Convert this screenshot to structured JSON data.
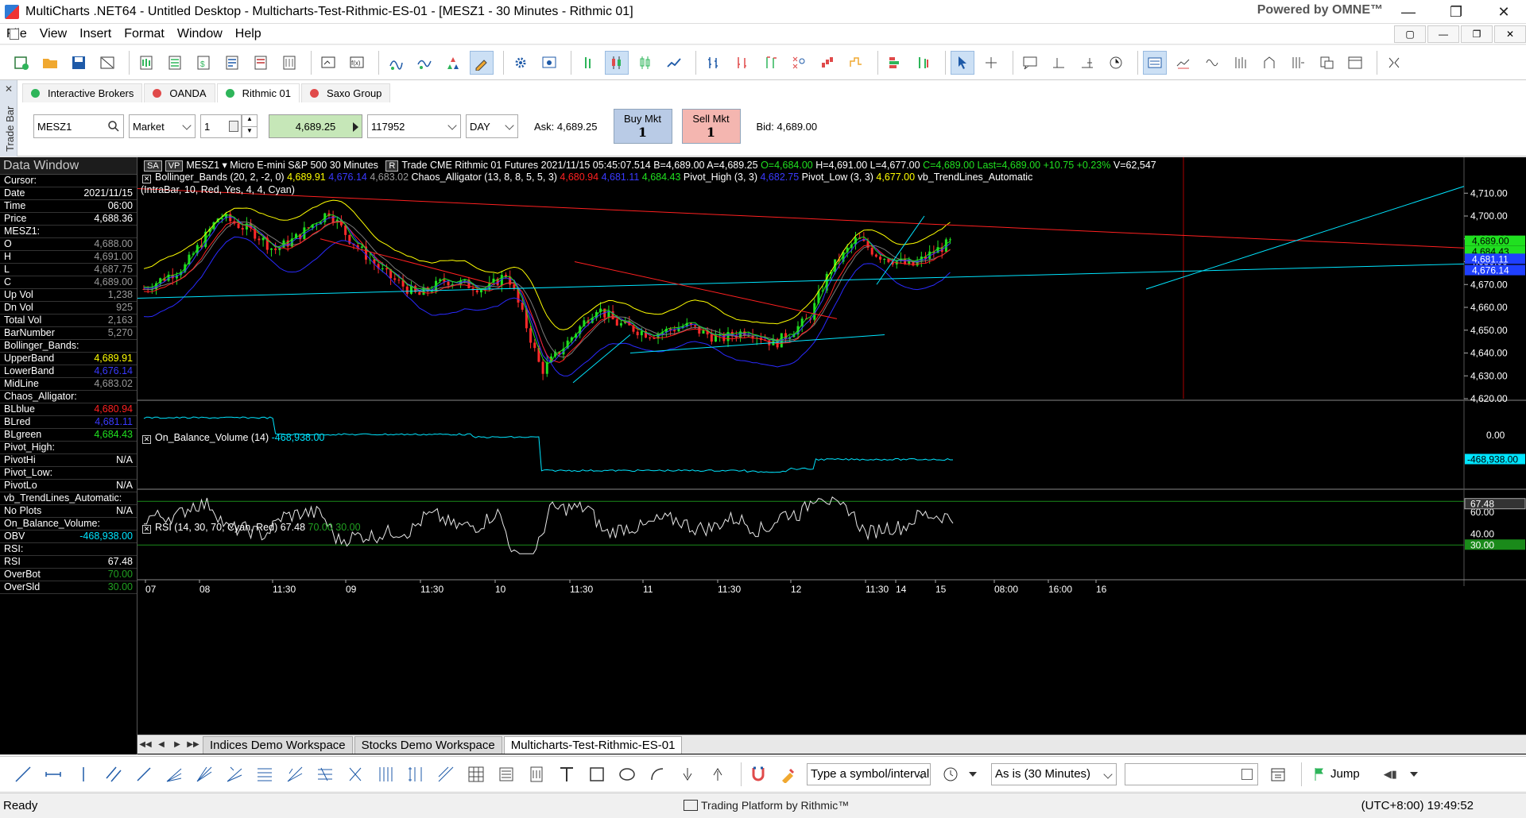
{
  "window": {
    "title": "MultiCharts .NET64 - Untitled Desktop - Multicharts-Test-Rithmic-ES-01 - [MESZ1 - 30 Minutes - Rithmic 01]",
    "powered": "Powered by OMNE™"
  },
  "menu": [
    "File",
    "View",
    "Insert",
    "Format",
    "Window",
    "Help"
  ],
  "tradebar": {
    "side_label": "Trade Bar",
    "brokers": [
      {
        "label": "Interactive Brokers",
        "color": "#2eb55a"
      },
      {
        "label": "OANDA",
        "color": "#e04a4a"
      },
      {
        "label": "Rithmic 01",
        "color": "#2eb55a"
      },
      {
        "label": "Saxo Group",
        "color": "#e04a4a"
      }
    ],
    "symbol": "MESZ1",
    "order_type": "Market",
    "quantity": "1",
    "price": "4,689.25",
    "account": "117952",
    "tif": "DAY",
    "ask": "Ask: 4,689.25",
    "buy_label": "Buy Mkt",
    "buy_qty": "1",
    "sell_label": "Sell Mkt",
    "sell_qty": "1",
    "bid": "Bid: 4,689.00"
  },
  "data_window": {
    "title": "Data Window",
    "rows": [
      {
        "k": "Cursor:",
        "v": "",
        "sec": true
      },
      {
        "k": "Date",
        "v": "2021/11/15",
        "c": "#ffffff"
      },
      {
        "k": "Time",
        "v": "06:00",
        "c": "#ffffff"
      },
      {
        "k": "Price",
        "v": "4,688.36",
        "c": "#ffffff"
      },
      {
        "k": "MESZ1:",
        "v": "",
        "sec": true
      },
      {
        "k": "O",
        "v": "4,688.00",
        "c": "#9a9a9a"
      },
      {
        "k": "H",
        "v": "4,691.00",
        "c": "#9a9a9a"
      },
      {
        "k": "L",
        "v": "4,687.75",
        "c": "#9a9a9a"
      },
      {
        "k": "C",
        "v": "4,689.00",
        "c": "#9a9a9a"
      },
      {
        "k": "Up Vol",
        "v": "1,238",
        "c": "#9a9a9a"
      },
      {
        "k": "Dn Vol",
        "v": "925",
        "c": "#9a9a9a"
      },
      {
        "k": "Total Vol",
        "v": "2,163",
        "c": "#9a9a9a"
      },
      {
        "k": "BarNumber",
        "v": "5,270",
        "c": "#9a9a9a"
      },
      {
        "k": "Bollinger_Bands:",
        "v": "",
        "sec": true
      },
      {
        "k": "UpperBand",
        "v": "4,689.91",
        "c": "#ffff00"
      },
      {
        "k": "LowerBand",
        "v": "4,676.14",
        "c": "#3a3aff"
      },
      {
        "k": "MidLine",
        "v": "4,683.02",
        "c": "#9a9a9a"
      },
      {
        "k": "Chaos_Alligator:",
        "v": "",
        "sec": true
      },
      {
        "k": "BLblue",
        "v": "4,680.94",
        "c": "#ff2020"
      },
      {
        "k": "BLred",
        "v": "4,681.11",
        "c": "#3a3aff"
      },
      {
        "k": "BLgreen",
        "v": "4,684.43",
        "c": "#20e020"
      },
      {
        "k": "Pivot_High:",
        "v": "",
        "sec": true
      },
      {
        "k": "PivotHi",
        "v": "N/A",
        "c": "#ffffff"
      },
      {
        "k": "Pivot_Low:",
        "v": "",
        "sec": true
      },
      {
        "k": "PivotLo",
        "v": "N/A",
        "c": "#ffffff"
      },
      {
        "k": "vb_TrendLines_Automatic:",
        "v": "",
        "sec": true
      },
      {
        "k": "No Plots",
        "v": "N/A",
        "c": "#ffffff"
      },
      {
        "k": "On_Balance_Volume:",
        "v": "",
        "sec": true
      },
      {
        "k": "OBV",
        "v": "-468,938.00",
        "c": "#00e5ff"
      },
      {
        "k": "RSI:",
        "v": "",
        "sec": true
      },
      {
        "k": "RSI",
        "v": "67.48",
        "c": "#ffffff"
      },
      {
        "k": "OverBot",
        "v": "70.00",
        "c": "#20a020"
      },
      {
        "k": "OverSld",
        "v": "30.00",
        "c": "#20a020"
      }
    ]
  },
  "chart": {
    "tags": [
      "SA",
      "VP",
      "MESZ1",
      "R"
    ],
    "header": "MESZ1  ▾  Micro E-mini S&P 500  30 Minutes",
    "header_items": [
      {
        "t": "Trade  CME  Rithmic 01  Futures  2021/11/15  05:45:07.514  B=4,689.00  A=4,689.25  ",
        "c": "#ffffff"
      },
      {
        "t": "O=4,684.00  ",
        "c": "#20e020"
      },
      {
        "t": "H=4,691.00  L=4,677.00  ",
        "c": "#ffffff"
      },
      {
        "t": "C=4,689.00  Last=4,689.00  +10.75  +0.23%  ",
        "c": "#20e020"
      },
      {
        "t": "V=62,547",
        "c": "#ffffff"
      }
    ],
    "indicator_line1": [
      {
        "t": "Bollinger_Bands  (20, 2, -2, 0)  ",
        "c": "#ffffff"
      },
      {
        "t": "4,689.91  ",
        "c": "#ffff00"
      },
      {
        "t": "4,676.14  ",
        "c": "#3a3aff"
      },
      {
        "t": "4,683.02",
        "c": "#9a9a9a"
      },
      {
        "t": "   Chaos_Alligator  (13, 8, 8, 5, 5, 3)  ",
        "c": "#ffffff"
      },
      {
        "t": "4,680.94  ",
        "c": "#ff2020"
      },
      {
        "t": "4,681.11  ",
        "c": "#3a3aff"
      },
      {
        "t": "4,684.43",
        "c": "#20e020"
      },
      {
        "t": "   Pivot_High  (3, 3)  ",
        "c": "#ffffff"
      },
      {
        "t": "4,682.75",
        "c": "#3a3aff"
      },
      {
        "t": "   Pivot_Low  (3, 3)  ",
        "c": "#ffffff"
      },
      {
        "t": "4,677.00",
        "c": "#ffff00"
      },
      {
        "t": "   vb_TrendLines_Automatic",
        "c": "#ffffff"
      }
    ],
    "indicator_line2": "(IntraBar, 10, Red, Yes, 4, 4, Cyan)",
    "obv_legend_name": "On_Balance_Volume  (14)",
    "obv_legend_value": "-468,938.00",
    "rsi_legend_name": "RSI  (14, 30, 70, Cyan, Red)",
    "rsi_legend_value": "67.48",
    "rsi_legend_ob": "70.00",
    "rsi_legend_os": "30.00",
    "price_axis": [
      "4,710.00",
      "4,700.00",
      "4,690.00",
      "4,680.00",
      "4,670.00",
      "4,660.00",
      "4,650.00",
      "4,640.00",
      "4,630.00",
      "4,620.00"
    ],
    "price_flags": [
      {
        "label": "4,689.00",
        "bg": "#20e020",
        "fg": "#000000"
      },
      {
        "label": "4,684.43",
        "bg": "#20e020",
        "fg": "#000000"
      },
      {
        "label": "4,681.11",
        "bg": "#1f3fff",
        "fg": "#ffffff"
      },
      {
        "label": "4,676.14",
        "bg": "#1f3fff",
        "fg": "#ffffff"
      }
    ],
    "obv_axis": [
      "0.00"
    ],
    "obv_flag": "-468,938.00",
    "rsi_axis": [
      "60.00",
      "40.00"
    ],
    "rsi_flags": [
      "67.48",
      "30.00"
    ],
    "time_axis": [
      "07",
      "08",
      "11:30",
      "09",
      "11:30",
      "10",
      "11:30",
      "11",
      "11:30",
      "12",
      "11:30",
      "14",
      "15",
      "08:00",
      "16:00",
      "16"
    ]
  },
  "workspaces": [
    "Indices Demo Workspace",
    "Stocks Demo Workspace",
    "Multicharts-Test-Rithmic-ES-01"
  ],
  "drawbar": {
    "symbol_placeholder": "Type a symbol/interval",
    "resolution": "As is (30 Minutes)",
    "jump": "Jump"
  },
  "status": {
    "ready": "Ready",
    "rithmic": "Trading Platform by Rithmic™",
    "clock": "(UTC+8:00) 19:49:52"
  }
}
